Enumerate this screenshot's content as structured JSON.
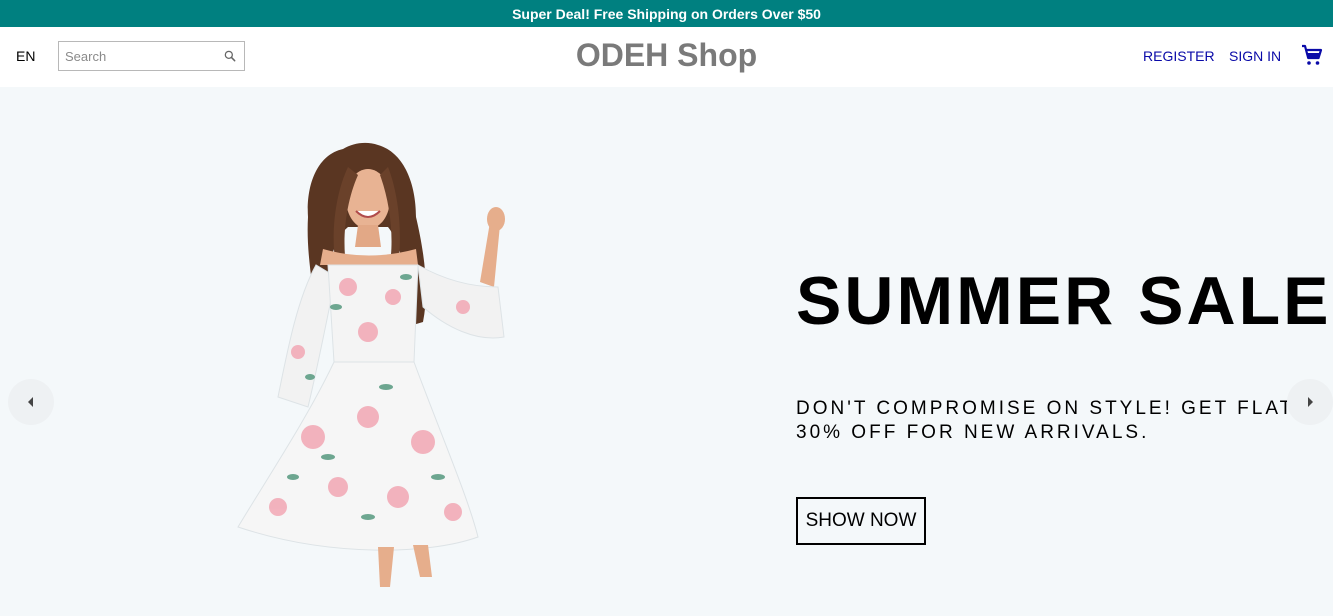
{
  "announcement": {
    "text": "Super Deal! Free Shipping on Orders Over $50",
    "background": "#008080"
  },
  "header": {
    "language": "EN",
    "search": {
      "placeholder": "Search",
      "value": ""
    },
    "logo": "ODEH Shop",
    "register_label": "REGISTER",
    "signin_label": "SIGN IN",
    "link_color": "#0a0aa8",
    "cart_icon": "shopping-cart-icon"
  },
  "slider": {
    "background": "#f4f8fa",
    "title": "SUMMER SALE",
    "description": "DON'T COMPROMISE ON STYLE! GET FLAT 30% OFF FOR NEW ARRIVALS.",
    "button_label": "SHOW NOW",
    "prev_icon": "arrow-left-icon",
    "next_icon": "arrow-right-icon",
    "image": "woman-in-floral-dress"
  }
}
